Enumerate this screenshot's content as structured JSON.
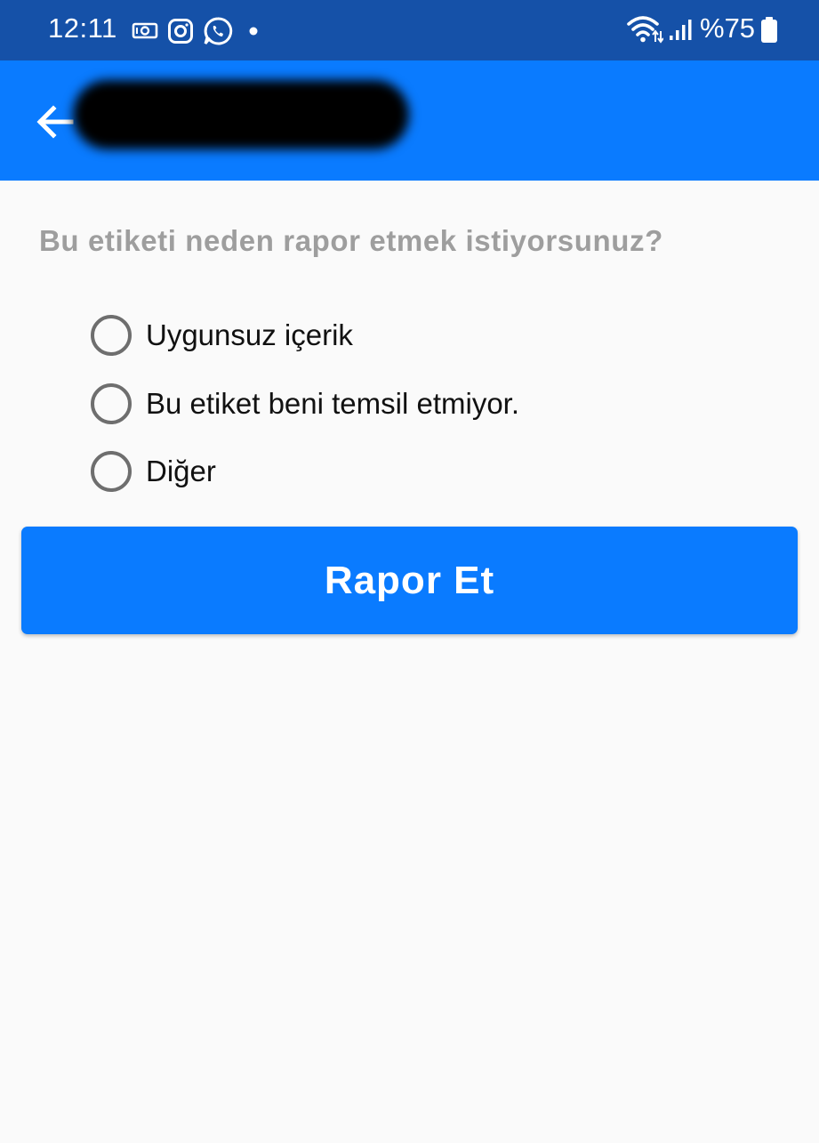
{
  "status_bar": {
    "time": "12:11",
    "notification_icons": [
      "money-icon",
      "instagram-icon",
      "whatsapp-icon",
      "dot-icon"
    ],
    "battery_percent": "%75",
    "background": "#1551a8"
  },
  "app_bar": {
    "back_icon": "arrow-left-icon",
    "title_redacted": true,
    "background": "#0a7bff"
  },
  "main": {
    "question": "Bu etiketi neden rapor etmek istiyorsunuz?",
    "options": [
      {
        "label": "Uygunsuz içerik",
        "selected": false
      },
      {
        "label": "Bu etiket beni temsil etmiyor.",
        "selected": false
      },
      {
        "label": "Diğer",
        "selected": false
      }
    ],
    "submit_label": "Rapor Et",
    "accent": "#0a7bff"
  }
}
